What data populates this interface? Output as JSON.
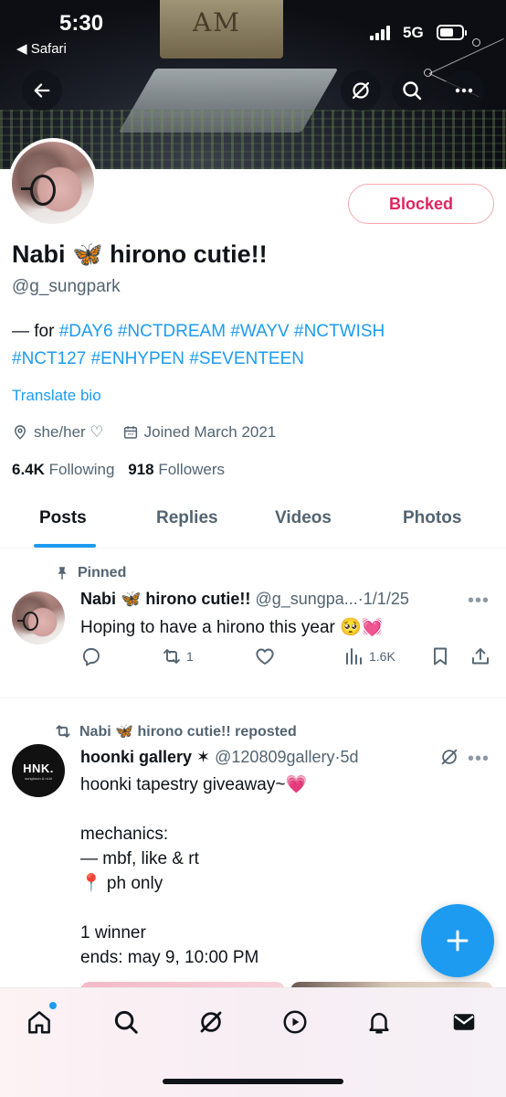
{
  "status_bar": {
    "time": "5:30",
    "back_app": "◀ Safari",
    "network": "5G"
  },
  "banner": {
    "sign_text": "AM"
  },
  "profile": {
    "name": "Nabi 🦋 hirono cutie!!",
    "handle": "@g_sungpark",
    "bio_prefix": "— for ",
    "bio_tags_line1": [
      "#DAY6",
      "#NCTDREAM",
      "#WAYV",
      "#NCTWISH"
    ],
    "bio_tags_line2": [
      "#NCT127",
      "#ENHYPEN",
      "#SEVENTEEN"
    ],
    "translate_label": "Translate bio",
    "pronouns": "she/her ♡",
    "joined": "Joined March 2021",
    "following_count": "6.4K",
    "following_label": "Following",
    "followers_count": "918",
    "followers_label": "Followers",
    "blocked_label": "Blocked"
  },
  "tabs": [
    {
      "label": "Posts",
      "active": true
    },
    {
      "label": "Replies",
      "active": false
    },
    {
      "label": "Videos",
      "active": false
    },
    {
      "label": "Photos",
      "active": false
    }
  ],
  "posts": [
    {
      "context": "Pinned",
      "name": "Nabi 🦋 hirono cutie!!",
      "handle": "@g_sungpa...",
      "dot": "·",
      "time": "1/1/25",
      "more": "•••",
      "text": "Hoping to have a hirono this year 🥺💓",
      "reposts": "1",
      "views": "1.6K"
    },
    {
      "context": "Nabi 🦋 hirono cutie!! reposted",
      "name": "hoonki gallery ✶",
      "handle": "@120809gallery",
      "dot": "·",
      "time": "5d",
      "more": "•••",
      "avatar_logo": "HNK.",
      "avatar_sub": "sunghoon & ni-ki",
      "text": "hoonki tapestry giveaway~💗\n\nmechanics:\n— mbf, like & rt\n📍 ph only\n\n1 winner\nends: may 9, 10:00 PM"
    }
  ],
  "colors": {
    "accent": "#1d9bf0",
    "blocked": "#e0245e",
    "muted": "#536471"
  },
  "icons": [
    "back-arrow-icon",
    "grok-icon",
    "search-icon",
    "more-icon",
    "location-icon",
    "calendar-icon",
    "pin-icon",
    "repost-icon",
    "reply-icon",
    "like-icon",
    "views-icon",
    "bookmark-icon",
    "share-icon",
    "compose-icon",
    "home-icon",
    "explore-icon",
    "video-icon",
    "notifications-icon",
    "messages-icon"
  ]
}
